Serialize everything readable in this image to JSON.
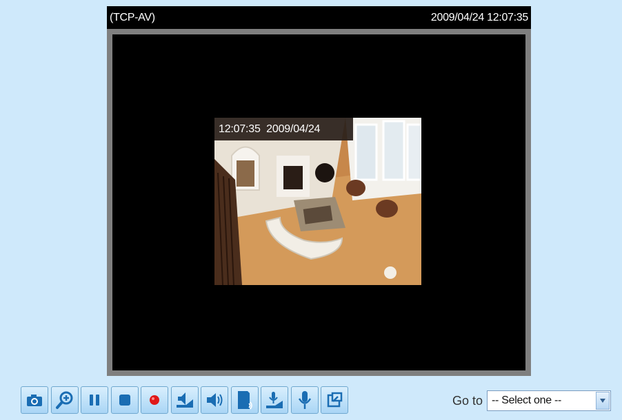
{
  "viewer": {
    "protocol": "(TCP-AV)",
    "datetime": "2009/04/24 12:07:35",
    "overlay_timestamp": "12:07:35  2009/04/24"
  },
  "toolbar": {
    "buttons": [
      {
        "name": "snapshot",
        "icon": "camera-icon"
      },
      {
        "name": "digital-zoom",
        "icon": "zoom-in-icon"
      },
      {
        "name": "pause",
        "icon": "pause-icon"
      },
      {
        "name": "stop",
        "icon": "stop-icon"
      },
      {
        "name": "record",
        "icon": "record-icon"
      },
      {
        "name": "volume",
        "icon": "volume-slider-icon"
      },
      {
        "name": "mute",
        "icon": "speaker-icon"
      },
      {
        "name": "talk",
        "icon": "talk-icon"
      },
      {
        "name": "mic-volume",
        "icon": "mic-slider-icon"
      },
      {
        "name": "microphone",
        "icon": "microphone-icon"
      },
      {
        "name": "fullscreen",
        "icon": "fullscreen-icon"
      }
    ]
  },
  "goto": {
    "label": "Go to",
    "selected": "-- Select one --"
  },
  "colors": {
    "background": "#cfe9fb",
    "button_icon": "#1a6db3",
    "record": "#e01818"
  }
}
